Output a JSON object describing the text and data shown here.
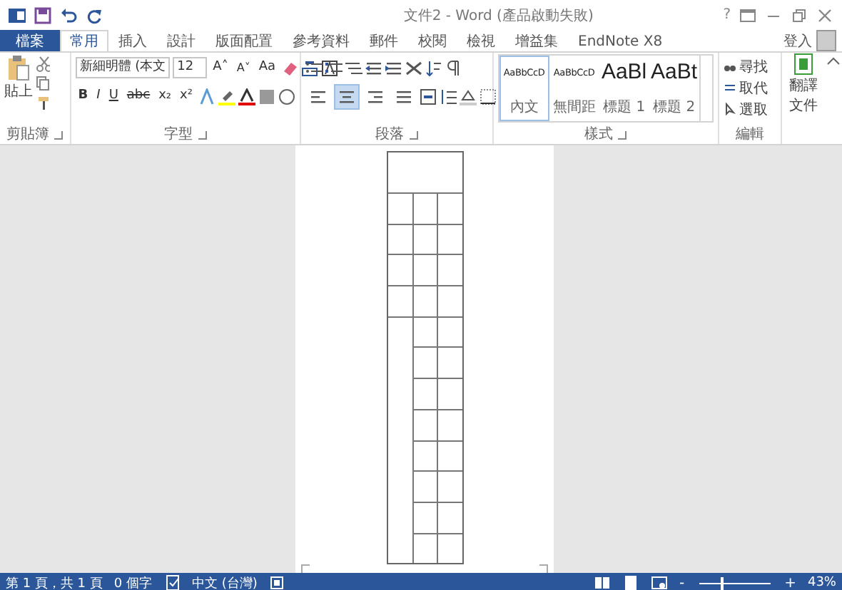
{
  "window": {
    "title": "文件2 - Word (產品啟動失敗)",
    "help": "?"
  },
  "tabs": [
    {
      "label": "檔案",
      "kind": "file",
      "selected": false
    },
    {
      "label": "常用",
      "kind": "tab",
      "selected": true
    },
    {
      "label": "插入",
      "kind": "tab",
      "selected": false
    },
    {
      "label": "設計",
      "kind": "tab",
      "selected": false
    },
    {
      "label": "版面配置",
      "kind": "tab",
      "selected": false
    },
    {
      "label": "參考資料",
      "kind": "tab",
      "selected": false
    },
    {
      "label": "郵件",
      "kind": "tab",
      "selected": false
    },
    {
      "label": "校閱",
      "kind": "tab",
      "selected": false
    },
    {
      "label": "檢視",
      "kind": "tab",
      "selected": false
    },
    {
      "label": "增益集",
      "kind": "tab",
      "selected": false
    },
    {
      "label": "EndNote X8",
      "kind": "tab",
      "selected": false
    }
  ],
  "sign_in": "登入",
  "clipboard": {
    "paste": "貼上",
    "label": "剪貼簿"
  },
  "font": {
    "name": "新細明體 (本文",
    "size": "12",
    "grow_button": "A˄",
    "shrink_button": "A˅",
    "case_button": "Aa",
    "format_buttons": [
      "B",
      "I",
      "U",
      "abc",
      "x₂",
      "x²"
    ],
    "label": "字型"
  },
  "paragraph": {
    "alignment": [
      {
        "selected": false
      },
      {
        "selected": true
      },
      {
        "selected": false
      },
      {
        "selected": false
      }
    ],
    "label": "段落"
  },
  "styles": {
    "items": [
      {
        "preview": "AaBbCcD",
        "name": "內文",
        "kind": "small",
        "selected": true
      },
      {
        "preview": "AaBbCcD",
        "name": "無間距",
        "kind": "small",
        "selected": false
      },
      {
        "preview": "AaBl",
        "name": "標題 1",
        "kind": "large",
        "selected": false
      },
      {
        "preview": "AaBt",
        "name": "標題 2",
        "kind": "large",
        "selected": false
      }
    ],
    "label": "樣式"
  },
  "editing": {
    "items": [
      "尋找",
      "取代",
      "選取"
    ],
    "label": "編輯"
  },
  "translate": {
    "lines": [
      "翻譯",
      "文件"
    ]
  },
  "status_bar": {
    "items": [
      "第 1 頁，共 1 頁",
      "0 個字",
      "中文 (台灣)"
    ],
    "zoom": {
      "minus": "-",
      "plus": "+",
      "level": 0.3,
      "reading": "43%"
    }
  }
}
